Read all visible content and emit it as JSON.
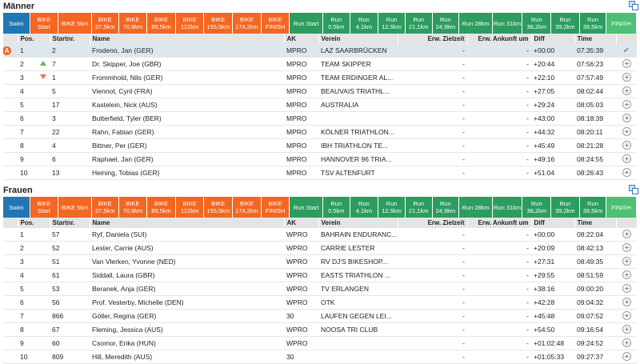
{
  "colors": {
    "swim": "#1f77b4",
    "bike": "#f26722",
    "run": "#2c9c5f",
    "finish": "#4cc074",
    "highlight": "#dfe7ee",
    "header": "#e4e4e4"
  },
  "tabs": [
    {
      "label": "Swim",
      "kind": "swim"
    },
    {
      "label": "BIKE\nStart",
      "kind": "bike"
    },
    {
      "label": "BIKE 5km",
      "kind": "bike"
    },
    {
      "label": "BIKE\n37,5km",
      "kind": "bike"
    },
    {
      "label": "BIKE\n70,9km",
      "kind": "bike"
    },
    {
      "label": "BIKE\n89,5km",
      "kind": "bike"
    },
    {
      "label": "BIKE\n122km",
      "kind": "bike"
    },
    {
      "label": "BIKE\n155,5km",
      "kind": "bike"
    },
    {
      "label": "BIKE\n174,2km",
      "kind": "bike"
    },
    {
      "label": "BIKE\nFINISH",
      "kind": "bike"
    },
    {
      "label": "Run Start",
      "kind": "run"
    },
    {
      "label": "Run\n0,5km",
      "kind": "run"
    },
    {
      "label": "Run\n4,1km",
      "kind": "run"
    },
    {
      "label": "Run\n12,5km",
      "kind": "run"
    },
    {
      "label": "Run\n21,1km",
      "kind": "run"
    },
    {
      "label": "Run\n24,9km",
      "kind": "run"
    },
    {
      "label": "Run 28km",
      "kind": "run"
    },
    {
      "label": "Run 31km",
      "kind": "run"
    },
    {
      "label": "Run\n38,2km",
      "kind": "run"
    },
    {
      "label": "Run\n39,2km",
      "kind": "run"
    },
    {
      "label": "Run\n39,5km",
      "kind": "run"
    },
    {
      "label": "FINISH",
      "kind": "finish"
    }
  ],
  "columns": {
    "pos": "Pos.",
    "startnr": "Startnr.",
    "name": "Name",
    "ak": "AK",
    "verein": "Verein",
    "zielzeit": "Erw. Zielzeit",
    "ankunft": "Erw. Ankunft um",
    "diff": "Diff",
    "time": "Time"
  },
  "maenner": {
    "title": "Männer",
    "rows": [
      {
        "pos": "1",
        "marker": "A",
        "startnr": "2",
        "name": "Frodeno, Jan (GER)",
        "ak": "MPRO",
        "verein": "LAZ SAARBRÜCKEN",
        "zielzeit": "-",
        "ankunft": "-",
        "diff": "+00:00",
        "time": "07:35:39",
        "action": "check"
      },
      {
        "pos": "2",
        "marker": "up",
        "startnr": "7",
        "name": "Dr. Skipper, Joe (GBR)",
        "ak": "MPRO",
        "verein": "TEAM SKIPPER",
        "zielzeit": "-",
        "ankunft": "-",
        "diff": "+20:44",
        "time": "07:56:23",
        "action": "plus"
      },
      {
        "pos": "3",
        "marker": "down",
        "startnr": "1",
        "name": "Frommhold, Nils (GER)",
        "ak": "MPRO",
        "verein": "TEAM ERDINGER AL...",
        "zielzeit": "-",
        "ankunft": "-",
        "diff": "+22:10",
        "time": "07:57:49",
        "action": "plus"
      },
      {
        "pos": "4",
        "marker": "",
        "startnr": "5",
        "name": "Viennot, Cyril (FRA)",
        "ak": "MPRO",
        "verein": "BEAUVAIS TRIATHL...",
        "zielzeit": "-",
        "ankunft": "-",
        "diff": "+27:05",
        "time": "08:02:44",
        "action": "plus"
      },
      {
        "pos": "5",
        "marker": "",
        "startnr": "17",
        "name": "Kastelein, Nick (AUS)",
        "ak": "MPRO",
        "verein": "AUSTRALIA",
        "zielzeit": "-",
        "ankunft": "-",
        "diff": "+29:24",
        "time": "08:05:03",
        "action": "plus"
      },
      {
        "pos": "6",
        "marker": "",
        "startnr": "3",
        "name": "Butterfield, Tyler (BER)",
        "ak": "MPRO",
        "verein": "",
        "zielzeit": "-",
        "ankunft": "-",
        "diff": "+43:00",
        "time": "08:18:39",
        "action": "plus"
      },
      {
        "pos": "7",
        "marker": "",
        "startnr": "22",
        "name": "Rahn, Fabian (GER)",
        "ak": "MPRO",
        "verein": "KÖLNER TRIATHLON...",
        "zielzeit": "-",
        "ankunft": "-",
        "diff": "+44:32",
        "time": "08:20:11",
        "action": "plus"
      },
      {
        "pos": "8",
        "marker": "",
        "startnr": "4",
        "name": "Bittner, Per (GER)",
        "ak": "MPRO",
        "verein": "IBH TRIATHLON TE...",
        "zielzeit": "-",
        "ankunft": "-",
        "diff": "+45:49",
        "time": "08:21:28",
        "action": "plus"
      },
      {
        "pos": "9",
        "marker": "",
        "startnr": "6",
        "name": "Raphael, Jan (GER)",
        "ak": "MPRO",
        "verein": "HANNOVER 96 TRIA...",
        "zielzeit": "-",
        "ankunft": "-",
        "diff": "+49:16",
        "time": "08:24:55",
        "action": "plus"
      },
      {
        "pos": "10",
        "marker": "",
        "startnr": "13",
        "name": "Heining, Tobias (GER)",
        "ak": "MPRO",
        "verein": "TSV ALTENFURT",
        "zielzeit": "-",
        "ankunft": "-",
        "diff": "+51:04",
        "time": "08:26:43",
        "action": "plus"
      }
    ]
  },
  "frauen": {
    "title": "Frauen",
    "rows": [
      {
        "pos": "1",
        "marker": "",
        "startnr": "57",
        "name": "Ryf, Daniela (SUI)",
        "ak": "WPRO",
        "verein": "BAHRAIN ENDURANC...",
        "zielzeit": "-",
        "ankunft": "-",
        "diff": "+00:00",
        "time": "08:22:04",
        "action": "plus"
      },
      {
        "pos": "2",
        "marker": "",
        "startnr": "52",
        "name": "Lester, Carrie (AUS)",
        "ak": "WPRO",
        "verein": "CARRIE LESTER",
        "zielzeit": "-",
        "ankunft": "-",
        "diff": "+20:09",
        "time": "08:42:13",
        "action": "plus"
      },
      {
        "pos": "3",
        "marker": "",
        "startnr": "51",
        "name": "Van Vlerken, Yvonne (NED)",
        "ak": "WPRO",
        "verein": "RV DJ'S BIKESHOP...",
        "zielzeit": "-",
        "ankunft": "-",
        "diff": "+27:31",
        "time": "08:49:35",
        "action": "plus"
      },
      {
        "pos": "4",
        "marker": "",
        "startnr": "61",
        "name": "Siddall, Laura (GBR)",
        "ak": "WPRO",
        "verein": "EASTS TRIATHLON ...",
        "zielzeit": "-",
        "ankunft": "-",
        "diff": "+29:55",
        "time": "08:51:59",
        "action": "plus"
      },
      {
        "pos": "5",
        "marker": "",
        "startnr": "53",
        "name": "Beranek, Anja (GER)",
        "ak": "WPRO",
        "verein": "TV ERLANGEN",
        "zielzeit": "-",
        "ankunft": "-",
        "diff": "+38:16",
        "time": "09:00:20",
        "action": "plus"
      },
      {
        "pos": "6",
        "marker": "",
        "startnr": "56",
        "name": "Prof. Vesterby, Michelle (DEN)",
        "ak": "WPRO",
        "verein": "OTK",
        "zielzeit": "-",
        "ankunft": "-",
        "diff": "+42:28",
        "time": "09:04:32",
        "action": "plus"
      },
      {
        "pos": "7",
        "marker": "",
        "startnr": "866",
        "name": "Göller, Regina (GER)",
        "ak": "30",
        "verein": "LAUFEN GEGEN LEI...",
        "zielzeit": "-",
        "ankunft": "-",
        "diff": "+45:48",
        "time": "09:07:52",
        "action": "plus"
      },
      {
        "pos": "8",
        "marker": "",
        "startnr": "67",
        "name": "Fleming, Jessica (AUS)",
        "ak": "WPRO",
        "verein": "NOOSA TRI CLUB",
        "zielzeit": "-",
        "ankunft": "-",
        "diff": "+54:50",
        "time": "09:16:54",
        "action": "plus"
      },
      {
        "pos": "9",
        "marker": "",
        "startnr": "60",
        "name": "Csomor, Erika (HUN)",
        "ak": "WPRO",
        "verein": "",
        "zielzeit": "-",
        "ankunft": "-",
        "diff": "+01:02:48",
        "time": "09:24:52",
        "action": "plus"
      },
      {
        "pos": "10",
        "marker": "",
        "startnr": "809",
        "name": "Hill, Meredith (AUS)",
        "ak": "30",
        "verein": "",
        "zielzeit": "-",
        "ankunft": "-",
        "diff": "+01:05:33",
        "time": "09:27:37",
        "action": "plus"
      }
    ]
  }
}
